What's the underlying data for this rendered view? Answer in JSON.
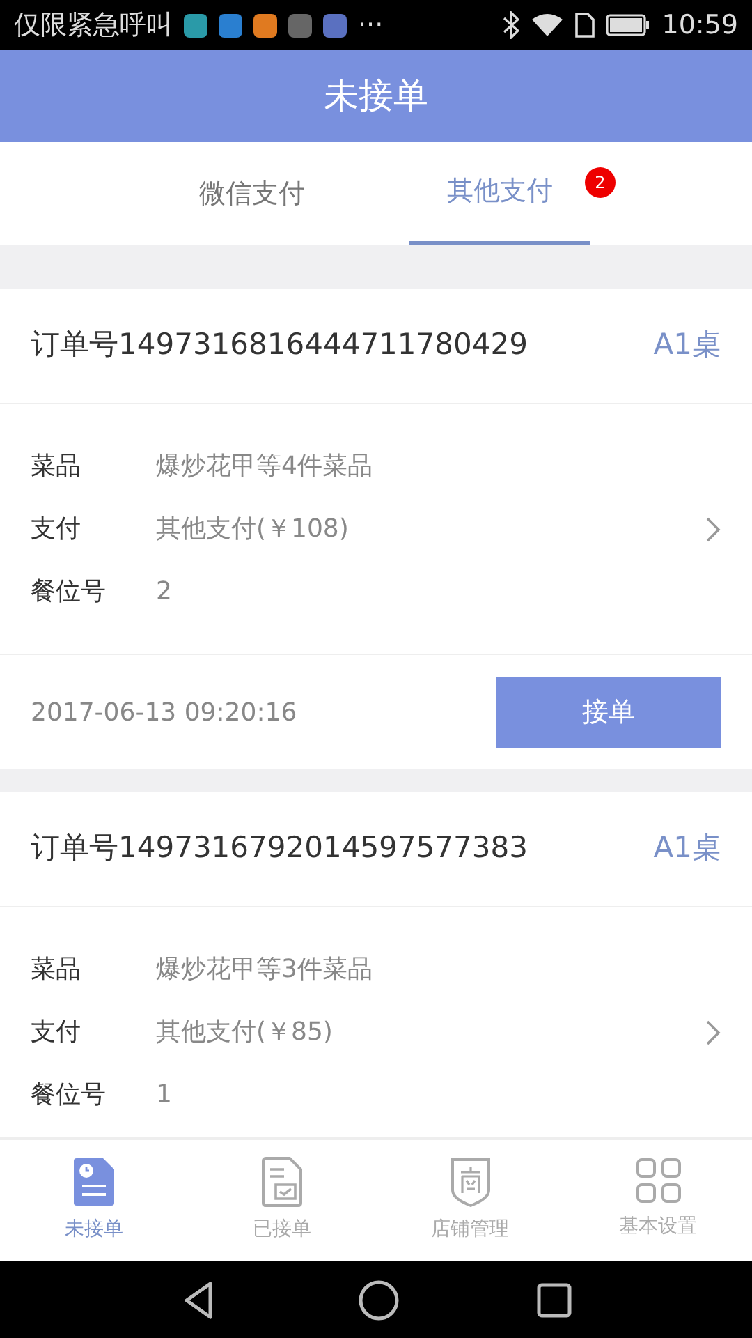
{
  "status_bar": {
    "carrier": "仅限紧急呼叫",
    "more": "···",
    "time": "10:59"
  },
  "header": {
    "title": "未接单"
  },
  "tabs": [
    {
      "label": "微信支付",
      "selected": false
    },
    {
      "label": "其他支付",
      "selected": true,
      "badge": "2"
    }
  ],
  "orders": [
    {
      "number": "订单号1497316816444711780429",
      "table": "A1桌",
      "fields": [
        {
          "label": "菜品",
          "value": "爆炒花甲等4件菜品",
          "arrow": false
        },
        {
          "label": "支付",
          "value": "其他支付(￥108)",
          "arrow": true
        },
        {
          "label": "餐位号",
          "value": "2",
          "arrow": false
        }
      ],
      "time": "2017-06-13 09:20:16",
      "action": "接单"
    },
    {
      "number": "订单号1497316792014597577383",
      "table": "A1桌",
      "fields": [
        {
          "label": "菜品",
          "value": "爆炒花甲等3件菜品",
          "arrow": false
        },
        {
          "label": "支付",
          "value": "其他支付(￥85)",
          "arrow": true
        },
        {
          "label": "餐位号",
          "value": "1",
          "arrow": false
        }
      ]
    }
  ],
  "bottom_nav": [
    {
      "label": "未接单",
      "kind": "pending",
      "selected": true
    },
    {
      "label": "已接单",
      "kind": "accepted",
      "selected": false
    },
    {
      "label": "店铺管理",
      "kind": "shop",
      "selected": false
    },
    {
      "label": "基本设置",
      "kind": "settings",
      "selected": false
    }
  ]
}
